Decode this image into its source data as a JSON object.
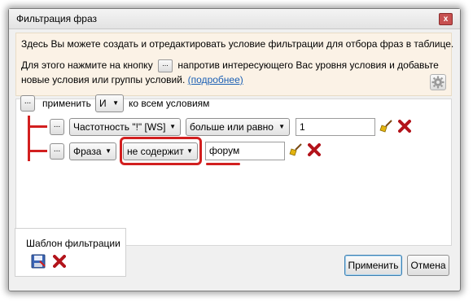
{
  "window": {
    "title": "Фильтрация фраз",
    "close_label": "x"
  },
  "info": {
    "line1": "Здесь Вы можете создать и отредактировать условие фильтрации для отбора фраз в таблице.",
    "line2_before": "Для этого нажмите на кнопку",
    "line2_button": "...",
    "line2_after": "напротив интересующего Вас уровня условия и добавьте",
    "line3": "новые условия или группы условий.",
    "link": "(подробнее)"
  },
  "root": {
    "button": "...",
    "apply_label": "применить",
    "operator": "И",
    "suffix": "ко всем условиям"
  },
  "conditions": [
    {
      "button": "...",
      "field": "Частотность \"!\" [WS]",
      "operator": "больше или равно",
      "value": "1"
    },
    {
      "button": "...",
      "field": "Фраза",
      "operator": "не содержит",
      "value": "форум"
    }
  ],
  "template": {
    "label": "Шаблон фильтрации"
  },
  "buttons": {
    "apply": "Применить",
    "cancel": "Отмена"
  },
  "colors": {
    "annotation": "#d21f1f",
    "link": "#1a5fb4",
    "delete": "#b3141b"
  },
  "icons": [
    "close-icon",
    "gear-icon",
    "broom-icon",
    "delete-icon",
    "save-template-icon",
    "chevron-down-icon"
  ]
}
